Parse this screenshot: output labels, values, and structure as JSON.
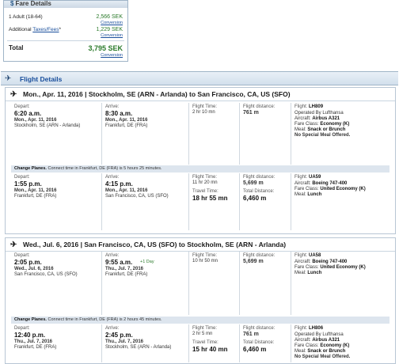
{
  "fare": {
    "title": "Fare Details",
    "adult_label": "1 Adult (18-64)",
    "adult_price": "2,566 SEK",
    "adult_conv": "Conversion",
    "additional_label": "Additional",
    "taxes_link": "Taxes/Fees",
    "taxes_star": "*",
    "taxes_price": "1,229 SEK",
    "taxes_conv": "Conversion",
    "total_label": "Total",
    "total_price": "3,795 SEK",
    "total_conv": "Conversion"
  },
  "flight_details_title": "Flight Details",
  "trips": [
    {
      "header": "Mon., Apr. 11, 2016 | Stockholm, SE (ARN - Arlanda) to San Francisco, CA, US (SFO)",
      "segments": [
        {
          "depart_label": "Depart:",
          "depart_time": "6:20 a.m.",
          "depart_date": "Mon., Apr. 11, 2016",
          "depart_place": "Stockholm, SE (ARN - Arlanda)",
          "arrive_label": "Arrive:",
          "arrive_time": "8:30 a.m.",
          "arrive_date": "Mon., Apr. 11, 2016",
          "arrive_place": "Frankfurt, DE (FRA)",
          "arrive_extra": "",
          "ft_label": "Flight Time:",
          "ft_value": "2 hr 10 mn",
          "tt_label": "",
          "tt_value": "",
          "fd_label": "Flight distance:",
          "fd_value": "761 m",
          "td_label": "",
          "td_value": "",
          "flight_label": "Flight:",
          "flight_no": "LH809",
          "operated": "Operated By Lufthansa",
          "aircraft_label": "Aircraft:",
          "aircraft": "Airbus A321",
          "class_label": "Fare Class:",
          "class": "Economy (K)",
          "meal_label": "Meal:",
          "meal": "Snack or Brunch",
          "special": "No Special Meal Offered."
        },
        {
          "depart_label": "Depart:",
          "depart_time": "1:55 p.m.",
          "depart_date": "Mon., Apr. 11, 2016",
          "depart_place": "Frankfurt, DE (FRA)",
          "arrive_label": "Arrive:",
          "arrive_time": "4:15 p.m.",
          "arrive_date": "Mon., Apr. 11, 2016",
          "arrive_place": "San Francisco, CA, US (SFO)",
          "arrive_extra": "",
          "ft_label": "Flight Time:",
          "ft_value": "11 hr 20 mn",
          "tt_label": "Travel Time:",
          "tt_value": "18 hr 55 mn",
          "fd_label": "Flight distance:",
          "fd_value": "5,699 m",
          "td_label": "Total Distance:",
          "td_value": "6,460 m",
          "flight_label": "Flight:",
          "flight_no": "UA59",
          "operated": "",
          "aircraft_label": "Aircraft:",
          "aircraft": "Boeing 747-400",
          "class_label": "Fare Class:",
          "class": "United Economy (K)",
          "meal_label": "Meal:",
          "meal": "Lunch",
          "special": ""
        }
      ],
      "change_label": "Change Planes.",
      "change_text": "Connect time in Frankfurt, DE (FRA) is 5 hours 25 minutes."
    },
    {
      "header": "Wed., Jul. 6, 2016 | San Francisco, CA, US (SFO) to Stockholm, SE (ARN - Arlanda)",
      "segments": [
        {
          "depart_label": "Depart:",
          "depart_time": "2:05 p.m.",
          "depart_date": "Wed., Jul. 6, 2016",
          "depart_place": "San Francisco, CA, US (SFO)",
          "arrive_label": "Arrive:",
          "arrive_time": "9:55 a.m.",
          "arrive_date": "Thu., Jul. 7, 2016",
          "arrive_place": "Frankfurt, DE (FRA)",
          "arrive_extra": "+1 Day",
          "ft_label": "Flight Time:",
          "ft_value": "10 hr 50 mn",
          "tt_label": "",
          "tt_value": "",
          "fd_label": "Flight distance:",
          "fd_value": "5,699 m",
          "td_label": "",
          "td_value": "",
          "flight_label": "Flight:",
          "flight_no": "UA58",
          "operated": "",
          "aircraft_label": "Aircraft:",
          "aircraft": "Boeing 747-400",
          "class_label": "Fare Class:",
          "class": "United Economy (K)",
          "meal_label": "Meal:",
          "meal": "Lunch",
          "special": ""
        },
        {
          "depart_label": "Depart:",
          "depart_time": "12:40 p.m.",
          "depart_date": "Thu., Jul. 7, 2016",
          "depart_place": "Frankfurt, DE (FRA)",
          "arrive_label": "Arrive:",
          "arrive_time": "2:45 p.m.",
          "arrive_date": "Thu., Jul. 7, 2016",
          "arrive_place": "Stockholm, SE (ARN - Arlanda)",
          "arrive_extra": "",
          "ft_label": "Flight Time:",
          "ft_value": "2 hr 5 mn",
          "tt_label": "Travel Time:",
          "tt_value": "15 hr 40 mn",
          "fd_label": "Flight distance:",
          "fd_value": "761 m",
          "td_label": "Total Distance:",
          "td_value": "6,460 m",
          "flight_label": "Flight:",
          "flight_no": "LH806",
          "operated": "Operated By Lufthansa",
          "aircraft_label": "Aircraft:",
          "aircraft": "Airbus A321",
          "class_label": "Fare Class:",
          "class": "Economy (K)",
          "meal_label": "Meal:",
          "meal": "Snack or Brunch",
          "special": "No Special Meal Offered."
        }
      ],
      "change_label": "Change Planes.",
      "change_text": "Connect time in Frankfurt, DE (FRA) is 2 hours 45 minutes."
    }
  ]
}
